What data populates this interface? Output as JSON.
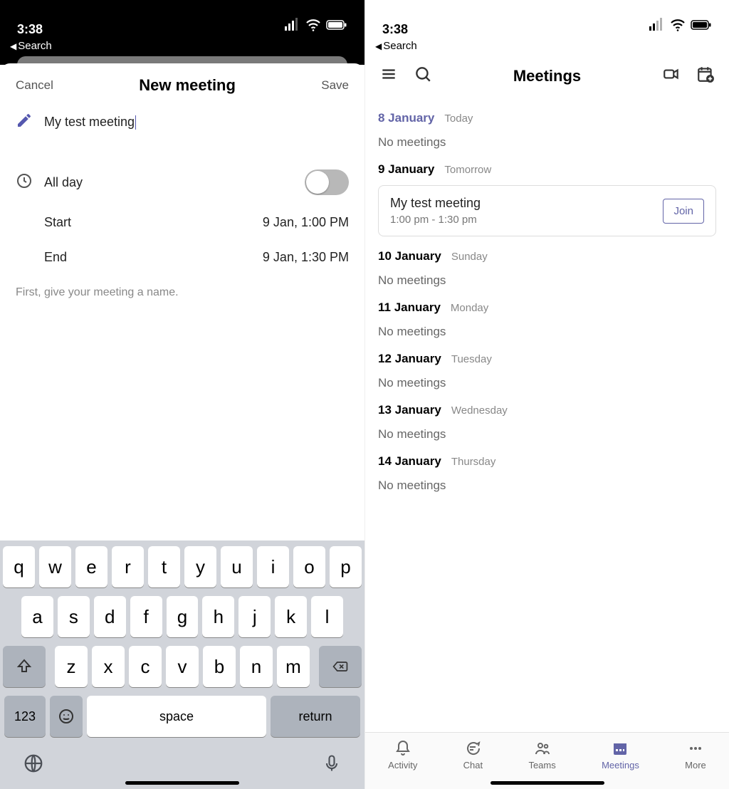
{
  "left": {
    "status_time": "3:38",
    "back_label": "Search",
    "header": {
      "cancel": "Cancel",
      "title": "New meeting",
      "save": "Save"
    },
    "meeting_title": "My test meeting",
    "all_day_label": "All day",
    "all_day_on": false,
    "start_label": "Start",
    "start_value": "9 Jan, 1:00 PM",
    "end_label": "End",
    "end_value": "9 Jan, 1:30 PM",
    "hint": "First, give your meeting a name.",
    "keyboard": {
      "row1": [
        "q",
        "w",
        "e",
        "r",
        "t",
        "y",
        "u",
        "i",
        "o",
        "p"
      ],
      "row2": [
        "a",
        "s",
        "d",
        "f",
        "g",
        "h",
        "j",
        "k",
        "l"
      ],
      "row3": [
        "z",
        "x",
        "c",
        "v",
        "b",
        "n",
        "m"
      ],
      "num": "123",
      "space": "space",
      "return": "return"
    }
  },
  "right": {
    "status_time": "3:38",
    "back_label": "Search",
    "header_title": "Meetings",
    "days": [
      {
        "date": "8 January",
        "sub": "Today",
        "accent": true,
        "meetings": [],
        "empty": "No meetings"
      },
      {
        "date": "9 January",
        "sub": "Tomorrow",
        "accent": false,
        "meetings": [
          {
            "title": "My test meeting",
            "time": "1:00 pm - 1:30 pm",
            "join": "Join"
          }
        ]
      },
      {
        "date": "10 January",
        "sub": "Sunday",
        "accent": false,
        "meetings": [],
        "empty": "No meetings"
      },
      {
        "date": "11 January",
        "sub": "Monday",
        "accent": false,
        "meetings": [],
        "empty": "No meetings"
      },
      {
        "date": "12 January",
        "sub": "Tuesday",
        "accent": false,
        "meetings": [],
        "empty": "No meetings"
      },
      {
        "date": "13 January",
        "sub": "Wednesday",
        "accent": false,
        "meetings": [],
        "empty": "No meetings"
      },
      {
        "date": "14 January",
        "sub": "Thursday",
        "accent": false,
        "meetings": [],
        "empty": "No meetings"
      }
    ],
    "tabs": [
      {
        "label": "Activity",
        "icon": "bell-icon"
      },
      {
        "label": "Chat",
        "icon": "chat-icon"
      },
      {
        "label": "Teams",
        "icon": "teams-icon"
      },
      {
        "label": "Meetings",
        "icon": "calendar-icon",
        "active": true
      },
      {
        "label": "More",
        "icon": "more-icon"
      }
    ]
  }
}
